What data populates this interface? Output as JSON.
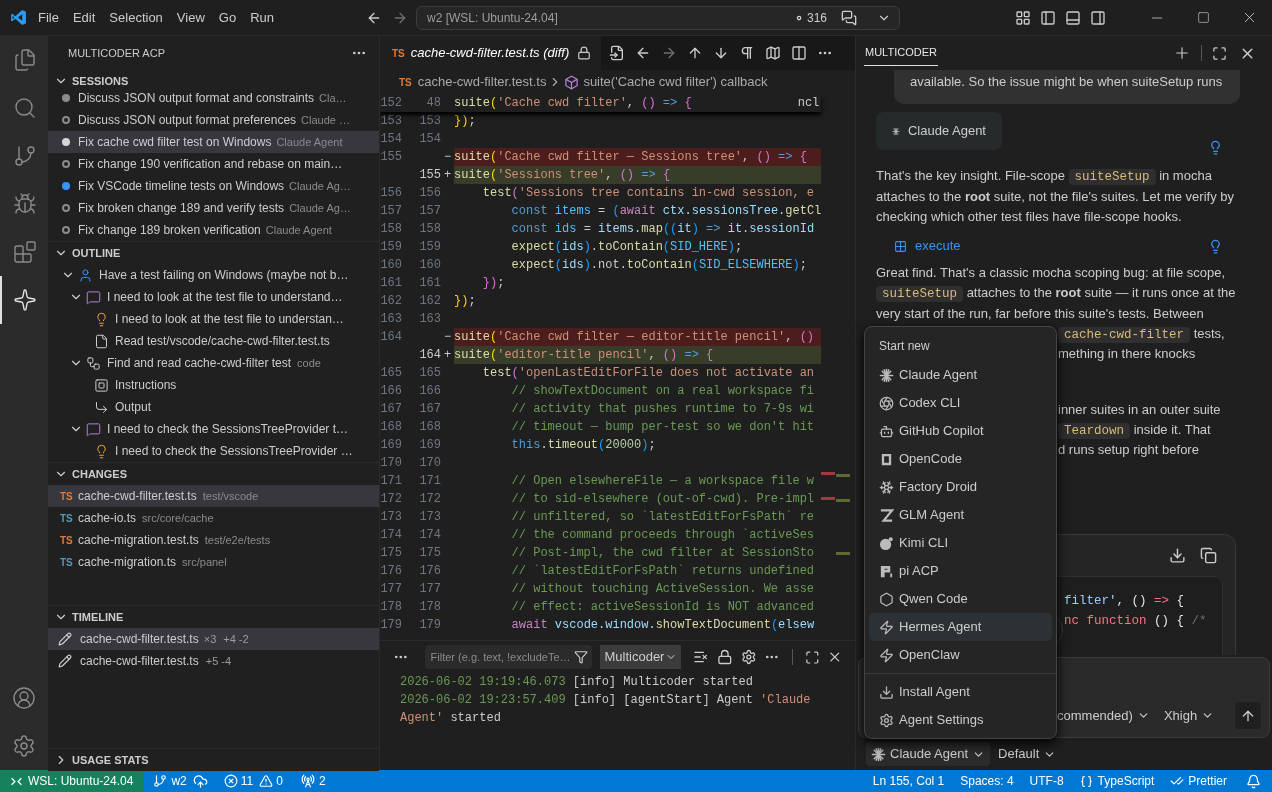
{
  "title_bar": {
    "menu": [
      "File",
      "Edit",
      "Selection",
      "View",
      "Go",
      "Run"
    ],
    "command_center": "w2 [WSL: Ubuntu-24.04]",
    "badge": "316"
  },
  "activity_bar": {
    "items": [
      {
        "kind": "explorer",
        "selected": false
      },
      {
        "kind": "search",
        "selected": false
      },
      {
        "kind": "source-control",
        "selected": false
      },
      {
        "kind": "run",
        "selected": false
      },
      {
        "kind": "extensions",
        "selected": false
      },
      {
        "kind": "multicoder",
        "selected": true
      }
    ],
    "bottom": [
      {
        "kind": "account"
      },
      {
        "kind": "manage"
      }
    ]
  },
  "sidebar": {
    "title": "MULTICODER ACP",
    "sessions": {
      "title": "SESSIONS",
      "expanded": true,
      "items": [
        {
          "title": "Discuss JSON output format and constraints",
          "agent": "Cla…",
          "filled": true,
          "color": "#8b8b8b",
          "selected": false
        },
        {
          "title": "Discuss JSON output format preferences",
          "agent": "Claude …",
          "filled": false,
          "color": "#8b8b8b",
          "selected": false
        },
        {
          "title": "Fix cache cwd filter test on Windows",
          "agent": "Claude Agent",
          "filled": true,
          "color": "#d4d4d4",
          "selected": true
        },
        {
          "title": "Fix change 190 verification and rebase on main…",
          "filled": false,
          "color": "#8b8b8b",
          "selected": false
        },
        {
          "title": "Fix VSCode timeline tests on Windows",
          "agent": "Claude Ag…",
          "filled": true,
          "color": "#3794ff",
          "selected": false
        },
        {
          "title": "Fix broken change 189 and verify tests",
          "agent": "Claude Ag…",
          "filled": false,
          "color": "#8b8b8b",
          "selected": false
        },
        {
          "title": "Fix change 189 broken verification",
          "agent": "Claude Agent",
          "filled": false,
          "color": "#8b8b8b",
          "selected": false
        }
      ]
    },
    "outline": {
      "title": "OUTLINE",
      "expanded": true,
      "items": [
        {
          "label": "Have a test failing on Windows (maybe not b…",
          "kind": "user",
          "expanded": true,
          "children": [
            {
              "label": "I need to look at the test file to understand…",
              "kind": "message",
              "expanded": true,
              "children": [
                {
                  "label": "I need to look at the test file to understan…",
                  "kind": "thought"
                },
                {
                  "label": "Read test/vscode/cache-cwd-filter.test.ts",
                  "kind": "file"
                }
              ]
            },
            {
              "label": "Find and read cache-cwd-filter test",
              "detail": "code",
              "kind": "tool",
              "expanded": true,
              "children": [
                {
                  "label": "Instructions",
                  "kind": "instructions"
                },
                {
                  "label": "Output",
                  "kind": "output"
                }
              ]
            },
            {
              "label": "I need to check the SessionsTreeProvider t…",
              "kind": "message",
              "expanded": true,
              "children": [
                {
                  "label": "I need to check the SessionsTreeProvider …",
                  "kind": "thought"
                }
              ]
            }
          ]
        }
      ]
    },
    "changes": {
      "title": "CHANGES",
      "expanded": true,
      "items": [
        {
          "badge": "TS",
          "name": "cache-cwd-filter.test.ts",
          "path": "test/vscode",
          "color": "#e37933",
          "selected": true
        },
        {
          "badge": "TS",
          "name": "cache-io.ts",
          "path": "src/core/cache",
          "color": "#519aba",
          "selected": false
        },
        {
          "badge": "TS",
          "name": "cache-migration.test.ts",
          "path": "test/e2e/tests",
          "color": "#e37933",
          "selected": false
        },
        {
          "badge": "TS",
          "name": "cache-migration.ts",
          "path": "src/panel",
          "color": "#519aba",
          "selected": false
        }
      ]
    },
    "timeline": {
      "title": "TIMELINE",
      "expanded": true,
      "items": [
        {
          "name": "cache-cwd-filter.test.ts",
          "count": "×3",
          "diff": "+4 -2",
          "selected": true
        },
        {
          "name": "cache-cwd-filter.test.ts",
          "diff": "+5 -4",
          "selected": false
        }
      ]
    },
    "usage_stats": {
      "title": "USAGE STATS",
      "expanded": false
    }
  },
  "editor": {
    "tab": {
      "badge": "TS",
      "title": "cache-cwd-filter.test.ts (diff)",
      "selected": true
    },
    "breadcrumb": {
      "badge": "TS",
      "file": "cache-cwd-filter.test.ts",
      "symbol": "suite('Cache cwd filter') callback"
    },
    "sticky": {
      "old": "152",
      "new": "48",
      "trailing": "ncl",
      "tokens": [
        {
          "text": "suite",
          "kind": "fn"
        },
        {
          "text": "(",
          "kind": "b1"
        },
        {
          "text": "'Cache cwd filter'",
          "kind": "str"
        },
        {
          "text": ", ",
          "kind": "punct"
        },
        {
          "text": "()",
          "kind": "b2"
        },
        {
          "text": " => ",
          "kind": "kw"
        },
        {
          "text": "{",
          "kind": "b2"
        }
      ]
    },
    "lines": [
      {
        "old": "153",
        "new": "153",
        "kind": "context",
        "tokens": [
          {
            "text": "})",
            "kind": "b1"
          },
          {
            "text": ";",
            "kind": "punct"
          }
        ]
      },
      {
        "old": "154",
        "new": "154",
        "kind": "context"
      },
      {
        "old": "155",
        "kind": "removed",
        "marker": "−",
        "tokens": [
          {
            "text": "suite",
            "kind": "fn"
          },
          {
            "text": "(",
            "kind": "b1"
          },
          {
            "text": "'Cache cwd filter — Sessions tree'",
            "kind": "str"
          },
          {
            "text": ", ",
            "kind": "punct"
          },
          {
            "text": "()",
            "kind": "b2"
          },
          {
            "text": " => ",
            "kind": "kw"
          },
          {
            "text": "{",
            "kind": "b2"
          }
        ]
      },
      {
        "new": "155",
        "kind": "added",
        "marker": "+",
        "tokens": [
          {
            "text": "suite",
            "kind": "fn"
          },
          {
            "text": "(",
            "kind": "b1"
          },
          {
            "text": "'Sessions tree'",
            "kind": "str"
          },
          {
            "text": ", ",
            "kind": "punct"
          },
          {
            "text": "()",
            "kind": "b2"
          },
          {
            "text": " => ",
            "kind": "kw"
          },
          {
            "text": "{",
            "kind": "b2"
          }
        ]
      },
      {
        "old": "156",
        "new": "156",
        "kind": "context",
        "tokens": [
          {
            "text": "    test",
            "kind": "fn"
          },
          {
            "text": "(",
            "kind": "b2"
          },
          {
            "text": "'Sessions tree contains in-cwd session, e",
            "kind": "str"
          }
        ]
      },
      {
        "old": "157",
        "new": "157",
        "kind": "context",
        "tokens": [
          {
            "text": "        const",
            "kind": "kw"
          },
          {
            "text": " items",
            "kind": "const"
          },
          {
            "text": " = ",
            "kind": "punct"
          },
          {
            "text": "(",
            "kind": "b3"
          },
          {
            "text": "await",
            "kind": "ctrl"
          },
          {
            "text": " ctx.sessionsTree.",
            "kind": "var"
          },
          {
            "text": "getCl",
            "kind": "fn"
          }
        ]
      },
      {
        "old": "158",
        "new": "158",
        "kind": "context",
        "tokens": [
          {
            "text": "        const",
            "kind": "kw"
          },
          {
            "text": " ids",
            "kind": "const"
          },
          {
            "text": " = ",
            "kind": "punct"
          },
          {
            "text": "items.",
            "kind": "var"
          },
          {
            "text": "map",
            "kind": "fn"
          },
          {
            "text": "((",
            "kind": "b3"
          },
          {
            "text": "it",
            "kind": "var"
          },
          {
            "text": ")",
            "kind": "b3"
          },
          {
            "text": " => ",
            "kind": "kw"
          },
          {
            "text": "it.sessionId",
            "kind": "var"
          }
        ]
      },
      {
        "old": "159",
        "new": "159",
        "kind": "context",
        "tokens": [
          {
            "text": "        expect",
            "kind": "fn"
          },
          {
            "text": "(",
            "kind": "b3"
          },
          {
            "text": "ids",
            "kind": "var"
          },
          {
            "text": ")",
            "kind": "b3"
          },
          {
            "text": ".",
            "kind": "punct"
          },
          {
            "text": "toContain",
            "kind": "fn"
          },
          {
            "text": "(",
            "kind": "b3"
          },
          {
            "text": "SID_HERE",
            "kind": "const"
          },
          {
            "text": ")",
            "kind": "b3"
          },
          {
            "text": ";",
            "kind": "punct"
          }
        ]
      },
      {
        "old": "160",
        "new": "160",
        "kind": "context",
        "tokens": [
          {
            "text": "        expect",
            "kind": "fn"
          },
          {
            "text": "(",
            "kind": "b3"
          },
          {
            "text": "ids",
            "kind": "var"
          },
          {
            "text": ")",
            "kind": "b3"
          },
          {
            "text": ".not.",
            "kind": "punct"
          },
          {
            "text": "toContain",
            "kind": "fn"
          },
          {
            "text": "(",
            "kind": "b3"
          },
          {
            "text": "SID_ELSEWHERE",
            "kind": "const"
          },
          {
            "text": ")",
            "kind": "b3"
          },
          {
            "text": ";",
            "kind": "punct"
          }
        ]
      },
      {
        "old": "161",
        "new": "161",
        "kind": "context",
        "tokens": [
          {
            "text": "    })",
            "kind": "b2"
          },
          {
            "text": ";",
            "kind": "punct"
          }
        ]
      },
      {
        "old": "162",
        "new": "162",
        "kind": "context",
        "tokens": [
          {
            "text": "})",
            "kind": "b1"
          },
          {
            "text": ";",
            "kind": "punct"
          }
        ]
      },
      {
        "old": "163",
        "new": "163",
        "kind": "context"
      },
      {
        "old": "164",
        "kind": "removed",
        "marker": "−",
        "tokens": [
          {
            "text": "suite",
            "kind": "fn"
          },
          {
            "text": "(",
            "kind": "b1"
          },
          {
            "text": "'Cache cwd filter — editor-title pencil'",
            "kind": "str"
          },
          {
            "text": ", ",
            "kind": "punct"
          },
          {
            "text": "()",
            "kind": "b2"
          }
        ]
      },
      {
        "new": "164",
        "kind": "added",
        "marker": "+",
        "tokens": [
          {
            "text": "suite",
            "kind": "fn"
          },
          {
            "text": "(",
            "kind": "b1"
          },
          {
            "text": "'editor-title pencil'",
            "kind": "str"
          },
          {
            "text": ", ",
            "kind": "punct"
          },
          {
            "text": "()",
            "kind": "b2"
          },
          {
            "text": " => ",
            "kind": "kw"
          },
          {
            "text": "{",
            "kind": "b2"
          }
        ]
      },
      {
        "old": "165",
        "new": "165",
        "kind": "context",
        "tokens": [
          {
            "text": "    test",
            "kind": "fn"
          },
          {
            "text": "(",
            "kind": "b2"
          },
          {
            "text": "'openLastEditForFile does not activate an",
            "kind": "str"
          }
        ]
      },
      {
        "old": "166",
        "new": "166",
        "kind": "context",
        "tokens": [
          {
            "text": "        // showTextDocument on a real workspace fi",
            "kind": "comment"
          }
        ]
      },
      {
        "old": "167",
        "new": "167",
        "kind": "context",
        "tokens": [
          {
            "text": "        // activity that pushes runtime to 7-9s wi",
            "kind": "comment"
          }
        ]
      },
      {
        "old": "168",
        "new": "168",
        "kind": "context",
        "tokens": [
          {
            "text": "        // timeout — bump per-test so we don't hit",
            "kind": "comment"
          }
        ]
      },
      {
        "old": "169",
        "new": "169",
        "kind": "context",
        "tokens": [
          {
            "text": "        this",
            "kind": "kw"
          },
          {
            "text": ".",
            "kind": "punct"
          },
          {
            "text": "timeout",
            "kind": "fn"
          },
          {
            "text": "(",
            "kind": "b3"
          },
          {
            "text": "20000",
            "kind": "num"
          },
          {
            "text": ")",
            "kind": "b3"
          },
          {
            "text": ";",
            "kind": "punct"
          }
        ]
      },
      {
        "old": "170",
        "new": "170",
        "kind": "context"
      },
      {
        "old": "171",
        "new": "171",
        "kind": "context",
        "tokens": [
          {
            "text": "        // Open elsewhereFile — a workspace file w",
            "kind": "comment"
          }
        ]
      },
      {
        "old": "172",
        "new": "172",
        "kind": "context",
        "tokens": [
          {
            "text": "        // to sid-elsewhere (out-of-cwd). Pre-impl",
            "kind": "comment"
          }
        ]
      },
      {
        "old": "173",
        "new": "173",
        "kind": "context",
        "tokens": [
          {
            "text": "        // unfiltered, so `latestEditForFsPath` re",
            "kind": "comment"
          }
        ]
      },
      {
        "old": "174",
        "new": "174",
        "kind": "context",
        "tokens": [
          {
            "text": "        // the command proceeds through `activeSes",
            "kind": "comment"
          }
        ]
      },
      {
        "old": "175",
        "new": "175",
        "kind": "context",
        "tokens": [
          {
            "text": "        // Post-impl, the cwd filter at SessionSto",
            "kind": "comment"
          }
        ]
      },
      {
        "old": "176",
        "new": "176",
        "kind": "context",
        "tokens": [
          {
            "text": "        // `latestEditForFsPath` returns undefined",
            "kind": "comment"
          }
        ]
      },
      {
        "old": "177",
        "new": "177",
        "kind": "context",
        "tokens": [
          {
            "text": "        // without touching ActiveSession. We asse",
            "kind": "comment"
          }
        ]
      },
      {
        "old": "178",
        "new": "178",
        "kind": "context",
        "tokens": [
          {
            "text": "        // effect: activeSessionId is NOT advanced",
            "kind": "comment"
          }
        ]
      },
      {
        "old": "179",
        "new": "179",
        "kind": "context",
        "tokens": [
          {
            "text": "        await",
            "kind": "ctrl"
          },
          {
            "text": " vscode.window.",
            "kind": "var"
          },
          {
            "text": "showTextDocument",
            "kind": "fn"
          },
          {
            "text": "(",
            "kind": "b3"
          },
          {
            "text": "elsew",
            "kind": "var"
          }
        ]
      }
    ]
  },
  "panel": {
    "filter_placeholder": "Filter (e.g. text, !excludeTe…",
    "channel": "Multicoder",
    "lines": [
      [
        {
          "text": "2026-06-02 19:19:46.073",
          "kind": "time"
        },
        {
          "text": " [info] Multicoder started",
          "kind": "plain"
        }
      ],
      [
        {
          "text": "2026-06-02 19:23:57.409",
          "kind": "time"
        },
        {
          "text": " [info] [agentStart] Agent ",
          "kind": "plain"
        },
        {
          "text": "'Claude Agent'",
          "kind": "str"
        },
        {
          "text": " started",
          "kind": "plain"
        }
      ]
    ]
  },
  "chat": {
    "tab": {
      "label": "MULTICODER",
      "selected": true
    },
    "user_bubble": "available. So the issue might be when suiteSetup runs",
    "agent": "Claude Agent",
    "paragraph_1": [
      {
        "kind": "text",
        "text": "That's the key insight. File-scope "
      },
      {
        "kind": "code",
        "text": "suiteSetup"
      },
      {
        "kind": "text",
        "text": " in mocha attaches to the **root** suite, not the file's suites. Let me verify by checking which other test files have file-scope hooks."
      }
    ],
    "tool": "execute",
    "paragraph_2": [
      {
        "kind": "text",
        "text": "Great find. That's a classic mocha scoping bug: at file scope, "
      },
      {
        "kind": "code",
        "text": "suiteSetup"
      },
      {
        "kind": "text",
        "text": " attaches to the **root** suite — it runs once at the very start of the run, far before this suite's tests. Between"
      }
    ],
    "fragment_groups": [
      [
        [
          {
            "kind": "code",
            "text": "cache-cwd-filter"
          },
          {
            "kind": "text",
            "text": " tests,"
          }
        ],
        [
          {
            "kind": "text",
            "text": "mething in there knocks"
          }
        ]
      ],
      [
        [
          {
            "kind": "text",
            "text": "inner suites in an outer suite"
          }
        ],
        [
          {
            "kind": "code",
            "text": "Teardown"
          },
          {
            "kind": "text",
            "text": " inside it. That"
          }
        ],
        [
          {
            "kind": "text",
            "text": "d runs setup right before"
          }
        ]
      ]
    ],
    "code_block": [
      [
        {
          "text": "filter'",
          "kind": "str"
        },
        {
          "text": ", () ",
          "kind": "punct"
        },
        {
          "text": "=>",
          "kind": "kw"
        },
        {
          "text": " {",
          "kind": "punct"
        }
      ],
      [
        {
          "text": "nc function",
          "kind": "kw"
        },
        {
          "text": " () { ",
          "kind": "punct"
        },
        {
          "text": "/*",
          "kind": "comment"
        }
      ]
    ],
    "model": "commended)",
    "effort": "Xhigh",
    "picker_agent": "Claude Agent",
    "picker_mode": "Default",
    "menu": {
      "header": "Start new",
      "agents": [
        {
          "label": "Claude Agent",
          "kind": "claude",
          "selected": false
        },
        {
          "label": "Codex CLI",
          "kind": "codex",
          "selected": false
        },
        {
          "label": "GitHub Copilot",
          "kind": "copilot",
          "selected": false
        },
        {
          "label": "OpenCode",
          "kind": "opencode",
          "selected": false
        },
        {
          "label": "Factory Droid",
          "kind": "factory",
          "selected": false
        },
        {
          "label": "GLM Agent",
          "kind": "glm",
          "selected": false
        },
        {
          "label": "Kimi CLI",
          "kind": "kimi",
          "selected": false
        },
        {
          "label": "pi ACP",
          "kind": "pi",
          "selected": false
        },
        {
          "label": "Qwen Code",
          "kind": "qwen",
          "selected": false
        },
        {
          "label": "Hermes Agent",
          "kind": "bolt",
          "selected": true
        },
        {
          "label": "OpenClaw",
          "kind": "bolt",
          "selected": false
        }
      ],
      "actions": [
        {
          "label": "Install Agent",
          "kind": "install"
        },
        {
          "label": "Agent Settings",
          "kind": "settings"
        }
      ]
    }
  },
  "status_bar": {
    "remote": "WSL: Ubuntu-24.04",
    "branch": "w2",
    "errors": "11",
    "warnings": "0",
    "ports": "2",
    "right": [
      {
        "kind": "position",
        "text": "Ln 155, Col 1"
      },
      {
        "kind": "indent",
        "text": "Spaces: 4"
      },
      {
        "kind": "encoding",
        "text": "UTF-8"
      },
      {
        "kind": "language",
        "text": "TypeScript"
      },
      {
        "kind": "formatter",
        "text": "Prettier"
      },
      {
        "kind": "notifications"
      }
    ]
  }
}
